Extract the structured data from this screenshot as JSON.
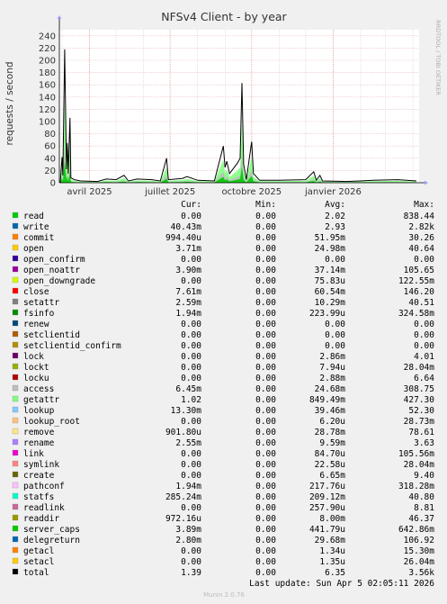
{
  "chart_data": {
    "type": "area",
    "title": "NFSv4 Client - by year",
    "ylabel": "requests / second",
    "ylim": [
      0,
      250
    ],
    "yticks": [
      0,
      20,
      40,
      60,
      80,
      100,
      120,
      140,
      160,
      180,
      200,
      220,
      240
    ],
    "xticks": [
      "avril 2025",
      "juillet 2025",
      "octobre 2025",
      "janvier 2026"
    ],
    "side_label": "RRDTOOL / TOBI OETIKER",
    "grid": true,
    "series_highlighted": [
      "read",
      "getattr",
      "access"
    ],
    "total_profile": [
      {
        "d": "2025-02-27",
        "v": 0
      },
      {
        "d": "2025-03-01",
        "v": 42
      },
      {
        "d": "2025-03-02",
        "v": 12
      },
      {
        "d": "2025-03-04",
        "v": 218
      },
      {
        "d": "2025-03-06",
        "v": 22
      },
      {
        "d": "2025-03-07",
        "v": 65
      },
      {
        "d": "2025-03-08",
        "v": 15
      },
      {
        "d": "2025-03-10",
        "v": 106
      },
      {
        "d": "2025-03-11",
        "v": 8
      },
      {
        "d": "2025-03-15",
        "v": 5
      },
      {
        "d": "2025-03-22",
        "v": 3
      },
      {
        "d": "2025-04-10",
        "v": 2
      },
      {
        "d": "2025-04-20",
        "v": 6
      },
      {
        "d": "2025-05-01",
        "v": 5
      },
      {
        "d": "2025-05-10",
        "v": 12
      },
      {
        "d": "2025-05-15",
        "v": 3
      },
      {
        "d": "2025-05-25",
        "v": 6
      },
      {
        "d": "2025-06-10",
        "v": 5
      },
      {
        "d": "2025-06-20",
        "v": 3
      },
      {
        "d": "2025-06-27",
        "v": 40
      },
      {
        "d": "2025-06-29",
        "v": 5
      },
      {
        "d": "2025-07-15",
        "v": 7
      },
      {
        "d": "2025-07-20",
        "v": 10
      },
      {
        "d": "2025-08-01",
        "v": 4
      },
      {
        "d": "2025-08-20",
        "v": 3
      },
      {
        "d": "2025-08-30",
        "v": 60
      },
      {
        "d": "2025-09-01",
        "v": 25
      },
      {
        "d": "2025-09-03",
        "v": 35
      },
      {
        "d": "2025-09-06",
        "v": 15
      },
      {
        "d": "2025-09-15",
        "v": 32
      },
      {
        "d": "2025-09-18",
        "v": 40
      },
      {
        "d": "2025-09-20",
        "v": 163
      },
      {
        "d": "2025-09-22",
        "v": 30
      },
      {
        "d": "2025-09-25",
        "v": 5
      },
      {
        "d": "2025-10-01",
        "v": 67
      },
      {
        "d": "2025-10-03",
        "v": 15
      },
      {
        "d": "2025-10-10",
        "v": 4
      },
      {
        "d": "2025-11-01",
        "v": 4
      },
      {
        "d": "2025-12-01",
        "v": 5
      },
      {
        "d": "2025-12-10",
        "v": 18
      },
      {
        "d": "2025-12-13",
        "v": 4
      },
      {
        "d": "2025-12-17",
        "v": 12
      },
      {
        "d": "2025-12-20",
        "v": 3
      },
      {
        "d": "2026-01-15",
        "v": 2
      },
      {
        "d": "2026-02-01",
        "v": 3
      },
      {
        "d": "2026-02-15",
        "v": 4
      },
      {
        "d": "2026-03-15",
        "v": 5
      },
      {
        "d": "2026-04-05",
        "v": 3
      }
    ],
    "columns": [
      "Cur:",
      "Min:",
      "Avg:",
      "Max:"
    ],
    "series": [
      {
        "name": "read",
        "color": "#00cc00",
        "cur": "0.00",
        "min": "0.00",
        "avg": "2.02",
        "max": "838.44"
      },
      {
        "name": "write",
        "color": "#0066b3",
        "cur": "40.43m",
        "min": "0.00",
        "avg": "2.93",
        "max": "2.82k"
      },
      {
        "name": "commit",
        "color": "#ff8000",
        "cur": "994.40u",
        "min": "0.00",
        "avg": "51.95m",
        "max": "30.26"
      },
      {
        "name": "open",
        "color": "#ffcc00",
        "cur": "3.71m",
        "min": "0.00",
        "avg": "24.98m",
        "max": "40.64"
      },
      {
        "name": "open_confirm",
        "color": "#330099",
        "cur": "0.00",
        "min": "0.00",
        "avg": "0.00",
        "max": "0.00"
      },
      {
        "name": "open_noattr",
        "color": "#990099",
        "cur": "3.90m",
        "min": "0.00",
        "avg": "37.14m",
        "max": "105.65"
      },
      {
        "name": "open_downgrade",
        "color": "#ccff00",
        "cur": "0.00",
        "min": "0.00",
        "avg": "75.83u",
        "max": "122.55m"
      },
      {
        "name": "close",
        "color": "#ff0000",
        "cur": "7.61m",
        "min": "0.00",
        "avg": "60.54m",
        "max": "146.20"
      },
      {
        "name": "setattr",
        "color": "#808080",
        "cur": "2.59m",
        "min": "0.00",
        "avg": "10.29m",
        "max": "40.51"
      },
      {
        "name": "fsinfo",
        "color": "#008f00",
        "cur": "1.94m",
        "min": "0.00",
        "avg": "223.99u",
        "max": "324.58m"
      },
      {
        "name": "renew",
        "color": "#00487d",
        "cur": "0.00",
        "min": "0.00",
        "avg": "0.00",
        "max": "0.00"
      },
      {
        "name": "setclientid",
        "color": "#b35a00",
        "cur": "0.00",
        "min": "0.00",
        "avg": "0.00",
        "max": "0.00"
      },
      {
        "name": "setclientid_confirm",
        "color": "#b38f00",
        "cur": "0.00",
        "min": "0.00",
        "avg": "0.00",
        "max": "0.00"
      },
      {
        "name": "lock",
        "color": "#6b006b",
        "cur": "0.00",
        "min": "0.00",
        "avg": "2.86m",
        "max": "4.01"
      },
      {
        "name": "lockt",
        "color": "#8fb300",
        "cur": "0.00",
        "min": "0.00",
        "avg": "7.94u",
        "max": "28.04m"
      },
      {
        "name": "locku",
        "color": "#b30000",
        "cur": "0.00",
        "min": "0.00",
        "avg": "2.88m",
        "max": "6.64"
      },
      {
        "name": "access",
        "color": "#bebebe",
        "cur": "6.45m",
        "min": "0.00",
        "avg": "24.68m",
        "max": "308.75"
      },
      {
        "name": "getattr",
        "color": "#80ff80",
        "cur": "1.02",
        "min": "0.00",
        "avg": "849.49m",
        "max": "427.30"
      },
      {
        "name": "lookup",
        "color": "#80c9ff",
        "cur": "13.30m",
        "min": "0.00",
        "avg": "39.46m",
        "max": "52.30"
      },
      {
        "name": "lookup_root",
        "color": "#ffc080",
        "cur": "0.00",
        "min": "0.00",
        "avg": "6.20u",
        "max": "28.73m"
      },
      {
        "name": "remove",
        "color": "#ffe680",
        "cur": "901.80u",
        "min": "0.00",
        "avg": "28.78m",
        "max": "78.61"
      },
      {
        "name": "rename",
        "color": "#aa80ff",
        "cur": "2.55m",
        "min": "0.00",
        "avg": "9.59m",
        "max": "3.63"
      },
      {
        "name": "link",
        "color": "#ee00cc",
        "cur": "0.00",
        "min": "0.00",
        "avg": "84.70u",
        "max": "105.56m"
      },
      {
        "name": "symlink",
        "color": "#ff8080",
        "cur": "0.00",
        "min": "0.00",
        "avg": "22.58u",
        "max": "28.04m"
      },
      {
        "name": "create",
        "color": "#666600",
        "cur": "0.00",
        "min": "0.00",
        "avg": "6.65m",
        "max": "9.40"
      },
      {
        "name": "pathconf",
        "color": "#ffbfff",
        "cur": "1.94m",
        "min": "0.00",
        "avg": "217.76u",
        "max": "318.28m"
      },
      {
        "name": "statfs",
        "color": "#00ffcc",
        "cur": "285.24m",
        "min": "0.00",
        "avg": "209.12m",
        "max": "40.80"
      },
      {
        "name": "readlink",
        "color": "#cc6699",
        "cur": "0.00",
        "min": "0.00",
        "avg": "257.90u",
        "max": "8.81"
      },
      {
        "name": "readdir",
        "color": "#999900",
        "cur": "972.16u",
        "min": "0.00",
        "avg": "8.00m",
        "max": "46.37"
      },
      {
        "name": "server_caps",
        "color": "#00cc00",
        "cur": "3.89m",
        "min": "0.00",
        "avg": "441.79u",
        "max": "642.86m"
      },
      {
        "name": "delegreturn",
        "color": "#0066b3",
        "cur": "2.80m",
        "min": "0.00",
        "avg": "29.68m",
        "max": "106.92"
      },
      {
        "name": "getacl",
        "color": "#ff8000",
        "cur": "0.00",
        "min": "0.00",
        "avg": "1.34u",
        "max": "15.30m"
      },
      {
        "name": "setacl",
        "color": "#ffcc00",
        "cur": "0.00",
        "min": "0.00",
        "avg": "1.35u",
        "max": "26.04m"
      },
      {
        "name": "total",
        "color": "#000000",
        "cur": "1.39",
        "min": "0.00",
        "avg": "6.35",
        "max": "3.56k"
      }
    ],
    "last_update": "Last update: Sun Apr  5 02:05:11 2026",
    "footer": "Munin 2.0.76"
  }
}
